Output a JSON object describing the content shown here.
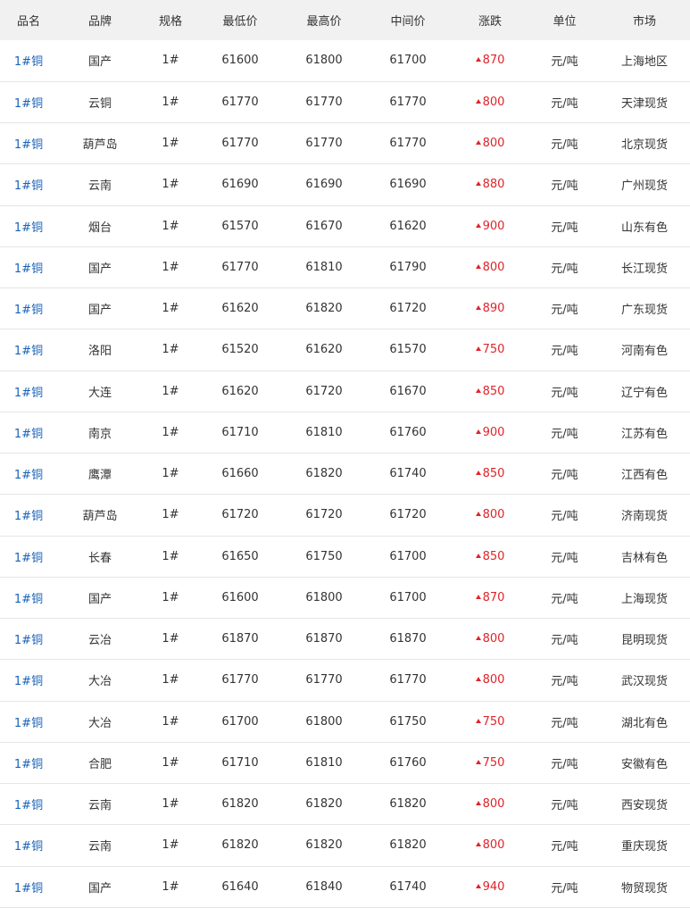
{
  "headers": [
    "品名",
    "品牌",
    "规格",
    "最低价",
    "最高价",
    "中间价",
    "涨跌",
    "单位",
    "市场"
  ],
  "colors": {
    "header_bg": "#f1f1f1",
    "link": "#1a62b8",
    "up": "#e0242a",
    "row_border": "#e5e5e5"
  },
  "rows": [
    {
      "name": "1#铜",
      "brand": "国产",
      "spec": "1#",
      "low": "61600",
      "high": "61800",
      "mid": "61700",
      "change": "870",
      "unit": "元/吨",
      "market": "上海地区"
    },
    {
      "name": "1#铜",
      "brand": "云铜",
      "spec": "1#",
      "low": "61770",
      "high": "61770",
      "mid": "61770",
      "change": "800",
      "unit": "元/吨",
      "market": "天津现货"
    },
    {
      "name": "1#铜",
      "brand": "葫芦岛",
      "spec": "1#",
      "low": "61770",
      "high": "61770",
      "mid": "61770",
      "change": "800",
      "unit": "元/吨",
      "market": "北京现货"
    },
    {
      "name": "1#铜",
      "brand": "云南",
      "spec": "1#",
      "low": "61690",
      "high": "61690",
      "mid": "61690",
      "change": "880",
      "unit": "元/吨",
      "market": "广州现货"
    },
    {
      "name": "1#铜",
      "brand": "烟台",
      "spec": "1#",
      "low": "61570",
      "high": "61670",
      "mid": "61620",
      "change": "900",
      "unit": "元/吨",
      "market": "山东有色"
    },
    {
      "name": "1#铜",
      "brand": "国产",
      "spec": "1#",
      "low": "61770",
      "high": "61810",
      "mid": "61790",
      "change": "800",
      "unit": "元/吨",
      "market": "长江现货"
    },
    {
      "name": "1#铜",
      "brand": "国产",
      "spec": "1#",
      "low": "61620",
      "high": "61820",
      "mid": "61720",
      "change": "890",
      "unit": "元/吨",
      "market": "广东现货"
    },
    {
      "name": "1#铜",
      "brand": "洛阳",
      "spec": "1#",
      "low": "61520",
      "high": "61620",
      "mid": "61570",
      "change": "750",
      "unit": "元/吨",
      "market": "河南有色"
    },
    {
      "name": "1#铜",
      "brand": "大连",
      "spec": "1#",
      "low": "61620",
      "high": "61720",
      "mid": "61670",
      "change": "850",
      "unit": "元/吨",
      "market": "辽宁有色"
    },
    {
      "name": "1#铜",
      "brand": "南京",
      "spec": "1#",
      "low": "61710",
      "high": "61810",
      "mid": "61760",
      "change": "900",
      "unit": "元/吨",
      "market": "江苏有色"
    },
    {
      "name": "1#铜",
      "brand": "鹰潭",
      "spec": "1#",
      "low": "61660",
      "high": "61820",
      "mid": "61740",
      "change": "850",
      "unit": "元/吨",
      "market": "江西有色"
    },
    {
      "name": "1#铜",
      "brand": "葫芦岛",
      "spec": "1#",
      "low": "61720",
      "high": "61720",
      "mid": "61720",
      "change": "800",
      "unit": "元/吨",
      "market": "济南现货"
    },
    {
      "name": "1#铜",
      "brand": "长春",
      "spec": "1#",
      "low": "61650",
      "high": "61750",
      "mid": "61700",
      "change": "850",
      "unit": "元/吨",
      "market": "吉林有色"
    },
    {
      "name": "1#铜",
      "brand": "国产",
      "spec": "1#",
      "low": "61600",
      "high": "61800",
      "mid": "61700",
      "change": "870",
      "unit": "元/吨",
      "market": "上海现货"
    },
    {
      "name": "1#铜",
      "brand": "云冶",
      "spec": "1#",
      "low": "61870",
      "high": "61870",
      "mid": "61870",
      "change": "800",
      "unit": "元/吨",
      "market": "昆明现货"
    },
    {
      "name": "1#铜",
      "brand": "大冶",
      "spec": "1#",
      "low": "61770",
      "high": "61770",
      "mid": "61770",
      "change": "800",
      "unit": "元/吨",
      "market": "武汉现货"
    },
    {
      "name": "1#铜",
      "brand": "大冶",
      "spec": "1#",
      "low": "61700",
      "high": "61800",
      "mid": "61750",
      "change": "750",
      "unit": "元/吨",
      "market": "湖北有色"
    },
    {
      "name": "1#铜",
      "brand": "合肥",
      "spec": "1#",
      "low": "61710",
      "high": "61810",
      "mid": "61760",
      "change": "750",
      "unit": "元/吨",
      "market": "安徽有色"
    },
    {
      "name": "1#铜",
      "brand": "云南",
      "spec": "1#",
      "low": "61820",
      "high": "61820",
      "mid": "61820",
      "change": "800",
      "unit": "元/吨",
      "market": "西安现货"
    },
    {
      "name": "1#铜",
      "brand": "云南",
      "spec": "1#",
      "low": "61820",
      "high": "61820",
      "mid": "61820",
      "change": "800",
      "unit": "元/吨",
      "market": "重庆现货"
    },
    {
      "name": "1#铜",
      "brand": "国产",
      "spec": "1#",
      "low": "61640",
      "high": "61840",
      "mid": "61740",
      "change": "940",
      "unit": "元/吨",
      "market": "物贸现货"
    }
  ]
}
